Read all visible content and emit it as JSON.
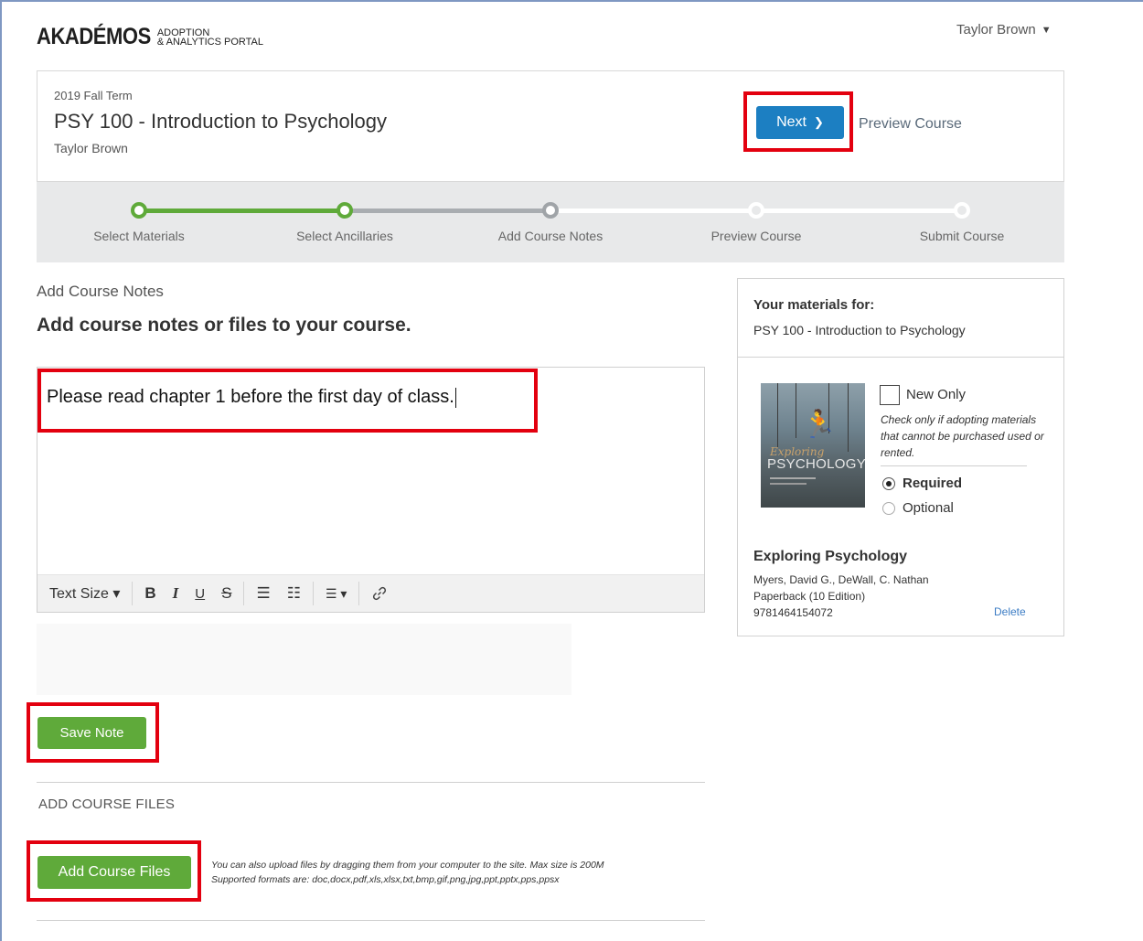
{
  "brand": {
    "name_main": "AKADÉMOS",
    "name_sub_line1": "ADOPTION",
    "name_sub_line2": "& ANALYTICS PORTAL"
  },
  "user_menu": {
    "name": "Taylor Brown",
    "caret": "▼"
  },
  "course": {
    "term": "2019 Fall Term",
    "title": "PSY 100 - Introduction to Psychology",
    "instructor": "Taylor Brown",
    "next_label": "Next",
    "next_icon": "❯",
    "preview_label": "Preview Course"
  },
  "stepper": {
    "steps": [
      {
        "label": "Select Materials",
        "status": "complete"
      },
      {
        "label": "Select Ancillaries",
        "status": "complete"
      },
      {
        "label": "Add Course Notes",
        "status": "current"
      },
      {
        "label": "Preview Course",
        "status": "upcoming"
      },
      {
        "label": "Submit Course",
        "status": "upcoming"
      }
    ],
    "colors": {
      "complete": "#5faa3a",
      "current": "#a0a4a8",
      "upcoming": "#ffffff"
    }
  },
  "notes": {
    "section_label": "Add Course Notes",
    "heading": "Add course notes or files to your course.",
    "editor_text": "Please read chapter 1 before the first day of class.",
    "toolbar": {
      "text_size": "Text Size ▾",
      "bold": "B",
      "italic": "I",
      "underline": "U",
      "strike": "S",
      "bullets": "☰",
      "numbered": "☷",
      "align": "☰ ▾",
      "link": "🔗"
    },
    "save_label": "Save Note"
  },
  "files": {
    "section_label": "ADD COURSE FILES",
    "button_label": "Add Course Files",
    "hint_line1": "You can also upload files by dragging them from your computer to the site. Max size is 200M",
    "hint_line2": "Supported formats are: doc,docx,pdf,xls,xlsx,txt,bmp,gif,png,jpg,ppt,pptx,pps,ppsx"
  },
  "materials": {
    "heading": "Your materials for:",
    "course": "PSY 100 - Introduction to Psychology",
    "cover_script": "Exploring",
    "cover_title": "PSYCHOLOGY",
    "new_only_label": "New Only",
    "new_only_hint": "Check only if adopting materials that cannot be purchased used or rented.",
    "required_label": "Required",
    "optional_label": "Optional",
    "book_title": "Exploring Psychology",
    "authors": "Myers, David G., DeWall, C. Nathan",
    "edition": "Paperback (10 Edition)",
    "isbn": "9781464154072",
    "delete_label": "Delete"
  },
  "colors": {
    "primary_blue": "#1c7fc2",
    "action_green": "#5faa3a",
    "highlight_red": "#e3000f"
  }
}
